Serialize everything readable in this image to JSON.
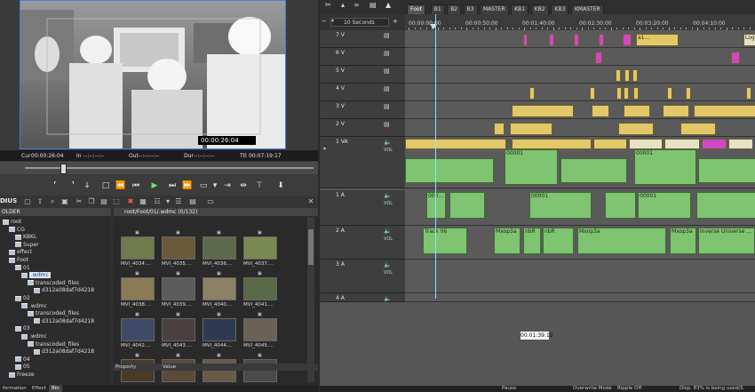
{
  "preview": {
    "timecode_overlay": "00:00:26:04",
    "cur_label": "Cur",
    "cur_value": "00:00:26:04",
    "in_label": "In",
    "in_value": "--:--:--:--",
    "out_label": "Out",
    "out_value": "--:--:--:--",
    "dur_label": "Dur",
    "dur_value": "--:--:--:--",
    "ttl_label": "Ttl",
    "ttl_value": "00:07:19:17"
  },
  "bin": {
    "title": "DIUS",
    "folder_header": "OLDER",
    "clip_header": "root/Foot/01/.wdmc (0/132)",
    "tree": [
      {
        "label": "root",
        "indent": 1,
        "selected": false
      },
      {
        "label": "CG",
        "indent": 2,
        "selected": false
      },
      {
        "label": "KBKL",
        "indent": 3,
        "selected": false
      },
      {
        "label": "Super",
        "indent": 3,
        "selected": false
      },
      {
        "label": "effect",
        "indent": 2,
        "selected": false
      },
      {
        "label": "Foot",
        "indent": 2,
        "selected": false
      },
      {
        "label": "01",
        "indent": 3,
        "selected": false
      },
      {
        "label": ".wdmc",
        "indent": 4,
        "selected": true
      },
      {
        "label": "transcoded_files",
        "indent": 5,
        "selected": false
      },
      {
        "label": "d312a08daf7d4218",
        "indent": 6,
        "selected": false
      },
      {
        "label": "02",
        "indent": 3,
        "selected": false
      },
      {
        "label": ".wdmc",
        "indent": 4,
        "selected": false
      },
      {
        "label": "transcoded_files",
        "indent": 5,
        "selected": false
      },
      {
        "label": "d312a08daf7d4218",
        "indent": 6,
        "selected": false
      },
      {
        "label": "03",
        "indent": 3,
        "selected": false
      },
      {
        "label": ".wdmc",
        "indent": 4,
        "selected": false
      },
      {
        "label": "transcoded_files",
        "indent": 5,
        "selected": false
      },
      {
        "label": "d312a08daf7d4218",
        "indent": 6,
        "selected": false
      },
      {
        "label": "04",
        "indent": 3,
        "selected": false
      },
      {
        "label": "05",
        "indent": 3,
        "selected": false
      },
      {
        "label": "Freeze",
        "indent": 2,
        "selected": false
      }
    ],
    "clips": [
      "MVI_4034....",
      "MVI_4035....",
      "MVI_4036....",
      "MVI_4037....",
      "MVI_4038....",
      "MVI_4039....",
      "MVI_4040....",
      "MVI_4041....",
      "MVI_4042....",
      "MVI_4043....",
      "MVI_4044....",
      "MVI_4045....",
      "",
      "",
      "",
      ""
    ],
    "property_label": "Property",
    "value_label": "Value",
    "bottom_tabs": [
      "formation",
      "Effect",
      "Bin"
    ]
  },
  "timeline": {
    "tabs": [
      "Foot",
      "B1",
      "B2",
      "B3",
      "MASTER",
      "KB1",
      "KB2",
      "KB3",
      "KMASTER"
    ],
    "active_tab": "Foot",
    "scale": "10 Seconds",
    "ruler_labels": [
      "00:00:00:00",
      "00:00:50:00",
      "00:01:40:00",
      "00:02:30:00",
      "00:03:20:00",
      "00:04:10:00"
    ],
    "tracks": [
      "7 V",
      "6 V",
      "5 V",
      "4 V",
      "3 V",
      "2 V",
      "1 VA",
      "1 A",
      "2 A",
      "3 A",
      "4 A"
    ],
    "vol_label": "VOL",
    "clip_labels": {
      "v7_a": "a1...",
      "v7_logo1": "Logo...",
      "v7_logo2": "Logo...",
      "va_1": "MVI_4148",
      "va_2": "MVI...",
      "va_3": "MVI_4149",
      "va_4": "1797...",
      "va_5": "MVI...",
      "va_6": "00134",
      "va_num1": "00001",
      "va_num2": "00001",
      "va_num3": "00134",
      "a1_1": "000...",
      "a1_2": "00001",
      "a1_3": "00001",
      "a2_track": "Track 06",
      "a2_mx1": "Mxop3a",
      "a2_nbr": "nbR",
      "a2_nbr2": "nbR",
      "a2_mx2": "Mxop3a",
      "a2_mx3": "Mxop3a",
      "a2_univ": "Inverse Universe ..."
    },
    "timecode_box": "00:01:39:15",
    "status": [
      "Pause",
      "Overwrite Mode",
      "Ripple Off",
      "Disp. 83% is being used(S"
    ]
  }
}
